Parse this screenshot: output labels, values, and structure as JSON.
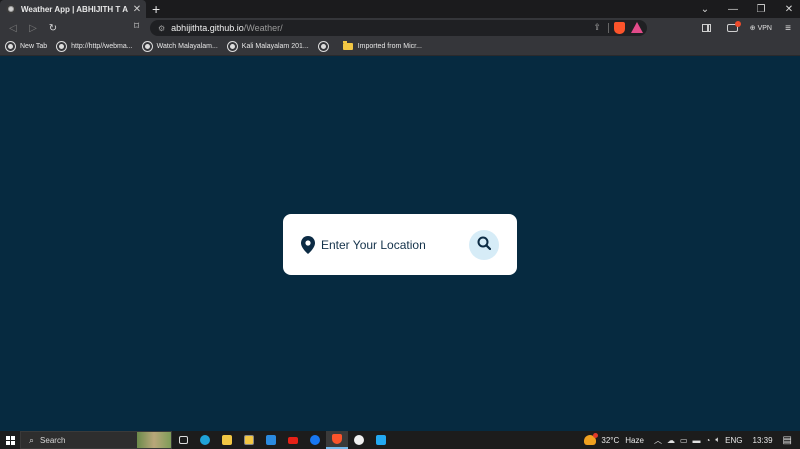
{
  "browser": {
    "tab_title": "Weather App | ABHIJITH T A",
    "tab_close": "✕",
    "new_tab": "+",
    "url_host": "abhijithta.github.io",
    "url_path": "/Weather/",
    "vpn_label": "VPN",
    "window_controls": {
      "minimize": "—",
      "restore": "❐",
      "close": "✕",
      "dropdown": "⌄"
    }
  },
  "bookmarks": [
    {
      "label": "New Tab",
      "icon": "globe-icon"
    },
    {
      "label": "http://http//webma...",
      "icon": "globe-icon"
    },
    {
      "label": "Watch Malayalam...",
      "icon": "globe-icon"
    },
    {
      "label": "Kali Malayalam 201...",
      "icon": "globe-icon"
    },
    {
      "label": "",
      "icon": "globe-icon"
    },
    {
      "label": "Imported from Micr...",
      "icon": "folder-icon"
    }
  ],
  "search": {
    "placeholder": "Enter Your Location",
    "value": ""
  },
  "colors": {
    "page_bg": "#062a40",
    "card_bg": "#ffffff",
    "search_btn_bg": "#d6ecf7",
    "accent": "#0c2b44"
  },
  "taskbar": {
    "search_label": "Search",
    "weather_temp": "32°C",
    "weather_desc": "Haze",
    "language": "ENG",
    "time": "13:39",
    "apps": [
      "task-view-icon",
      "edge-icon",
      "file-explorer-icon",
      "store-icon",
      "mail-icon",
      "youtube-icon",
      "facebook-icon",
      "brave-icon",
      "github-icon",
      "vscode-icon"
    ]
  }
}
